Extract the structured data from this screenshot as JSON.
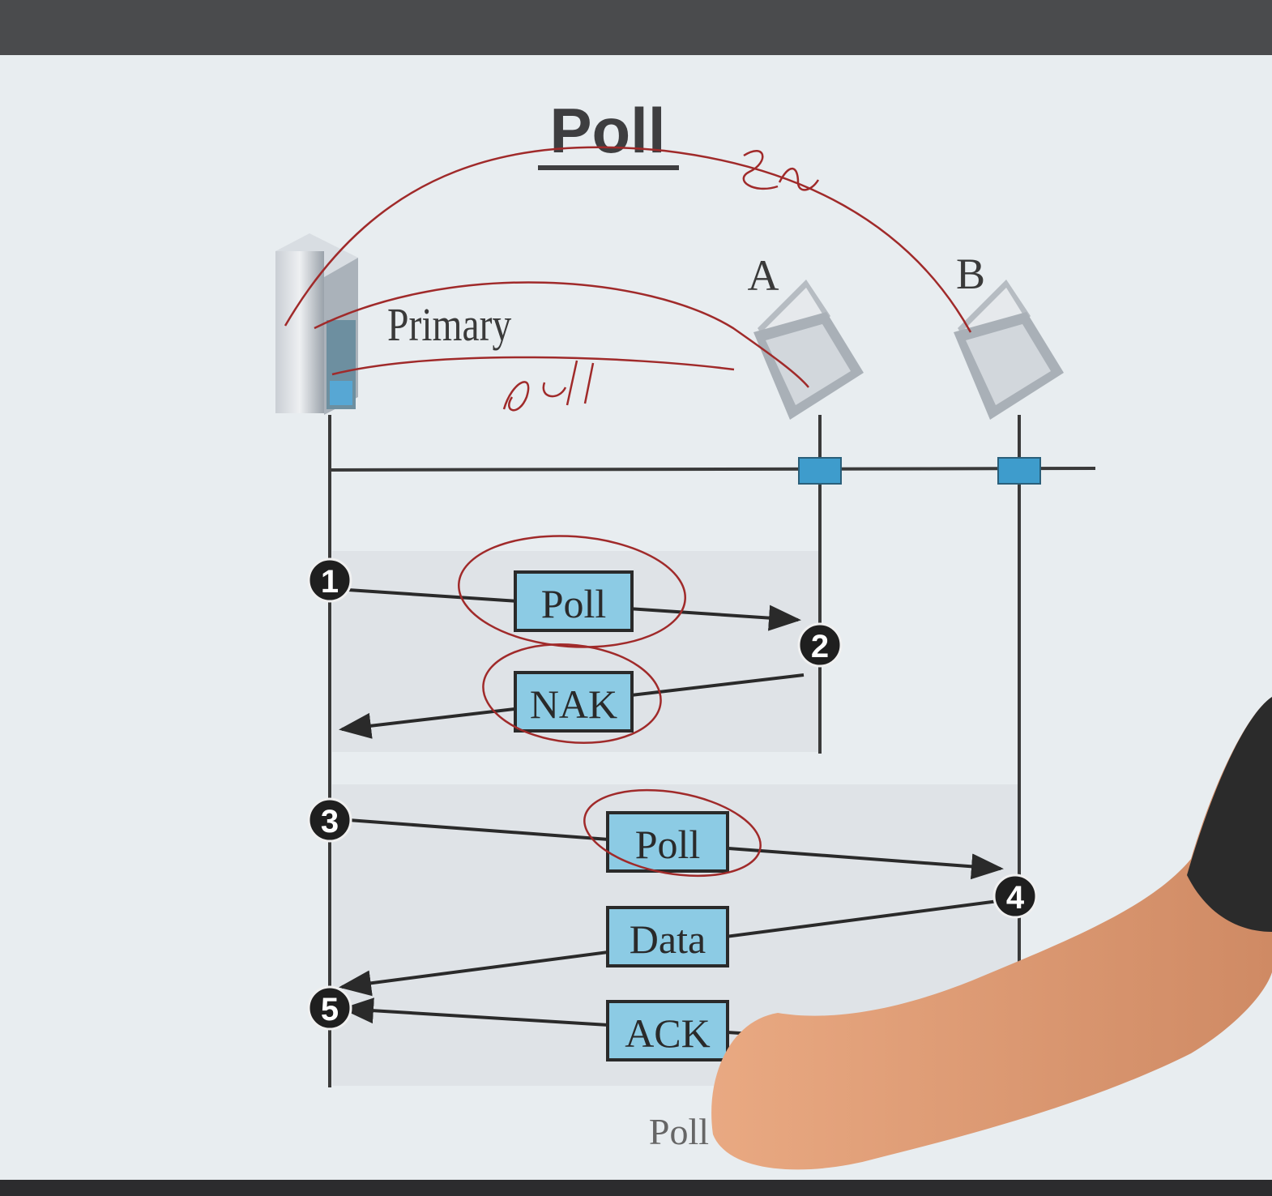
{
  "title": "Poll",
  "stations": {
    "primary_label": "Primary",
    "station_a_label": "A",
    "station_b_label": "B"
  },
  "steps": [
    {
      "number": "1"
    },
    {
      "number": "2"
    },
    {
      "number": "3"
    },
    {
      "number": "4"
    },
    {
      "number": "5"
    }
  ],
  "frames": [
    {
      "label": "Poll"
    },
    {
      "label": "NAK"
    },
    {
      "label": "Poll"
    },
    {
      "label": "Data"
    },
    {
      "label": "ACK"
    }
  ],
  "footer_caption": "Poll",
  "annotations": {
    "handwritten_1": "Sel",
    "handwritten_2": "Poll"
  },
  "colors": {
    "frame_fill": "#8ccbe4",
    "connector_fill": "#3e9ccc",
    "ink_red": "#a02a2a",
    "slide_bg": "#e7ecef",
    "bar_bg": "#4a4b4d"
  }
}
